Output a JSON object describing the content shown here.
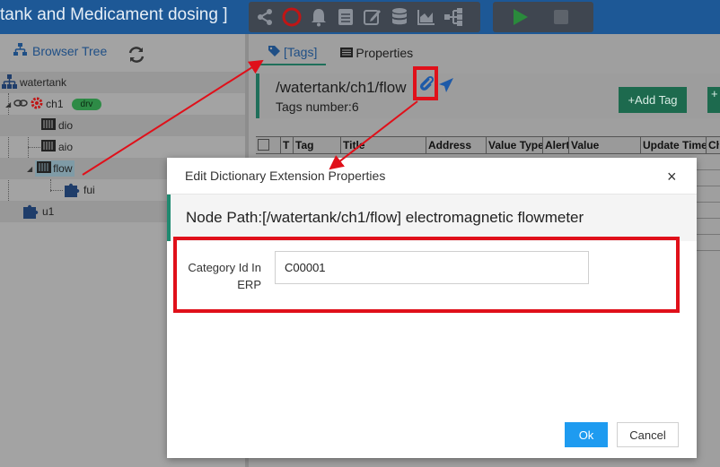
{
  "app": {
    "title": "tank and Medicament dosing ]"
  },
  "toolbar": {
    "tools": [
      "share-icon",
      "ring-icon",
      "bell-icon",
      "book-icon",
      "edit-icon",
      "database-icon",
      "area-chart-icon",
      "sitemap-icon"
    ],
    "run": [
      "play-icon",
      "stop-icon"
    ]
  },
  "left_panel": {
    "header": "Browser Tree",
    "tree": {
      "root": "watertank",
      "ch1": "ch1",
      "ch1_badge": "drv",
      "dio": "dio",
      "aio": "aio",
      "flow": "flow",
      "fui": "fui",
      "u1": "u1"
    }
  },
  "right_panel": {
    "tabs": [
      "[Tags]",
      "Properties"
    ],
    "path": "/watertank/ch1/flow",
    "tags_number": "Tags number:6",
    "add_tag": "+Add Tag",
    "add_other": "+",
    "columns": [
      "T",
      "Tag",
      "Title",
      "Address",
      "Value Type",
      "Alert",
      "Value",
      "Update Time",
      "Ch"
    ]
  },
  "dialog": {
    "title": "Edit Dictionary Extension Properties",
    "close": "×",
    "node_path": "Node Path:[/watertank/ch1/flow] electromagnetic flowmeter",
    "field_label": "Category Id In ERP",
    "field_value": "C00001",
    "ok": "Ok",
    "cancel": "Cancel"
  },
  "colors": {
    "header_bg": "#1d5896",
    "accent_green": "#1d6a4e",
    "ok_blue": "#1e9bf0",
    "highlight_red": "#e0101a"
  }
}
